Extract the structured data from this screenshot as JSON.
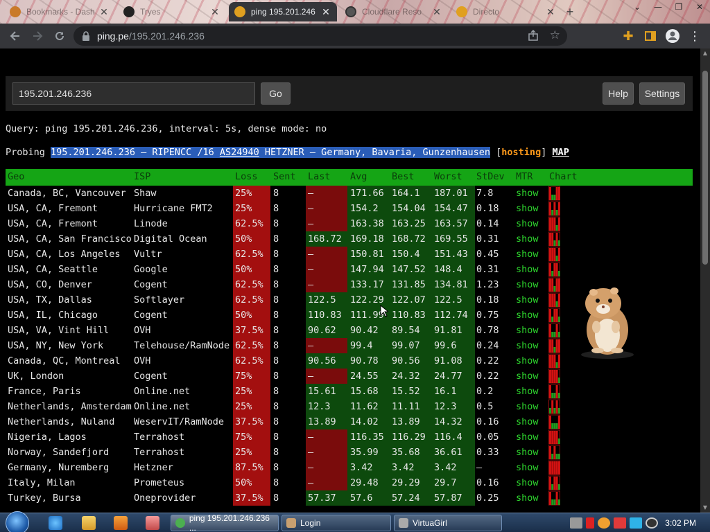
{
  "browser": {
    "tabs": [
      {
        "title": "Bookmarks - Dash",
        "favicon_color": "#c97a2a",
        "active": false
      },
      {
        "title": "Tryes",
        "favicon_color": "#222222",
        "active": false
      },
      {
        "title": "ping 195.201.246",
        "favicon_color": "#e0a020",
        "active": true
      },
      {
        "title": "Cloudflare Reso",
        "favicon_color": "#555555",
        "active": false
      },
      {
        "title": "Directo",
        "favicon_color": "#e0a020",
        "active": false
      }
    ],
    "new_tab_label": "+",
    "url_host": "ping.pe",
    "url_path": "/195.201.246.236"
  },
  "search": {
    "input_value": "195.201.246.236",
    "go_label": "Go",
    "help_label": "Help",
    "settings_label": "Settings"
  },
  "query_line": "Query: ping 195.201.246.236, interval: 5s, dense mode: no",
  "probe": {
    "prefix": "Probing ",
    "selected_a": "195.201.246.236 – RIPENCC /16 ",
    "asn": "AS24940",
    "selected_b": " HETZNER – Germany, Bavaria, Gunzenhausen",
    "open_bracket": " [",
    "hosting": "hosting",
    "close_bracket": "] ",
    "map": "MAP"
  },
  "table": {
    "headers": [
      "Geo",
      "ISP",
      "Loss",
      "Sent",
      "Last",
      "Avg",
      "Best",
      "Worst",
      "StDev",
      "MTR",
      "Chart"
    ],
    "rows": [
      {
        "geo": "Canada, BC, Vancouver",
        "isp": "Shaw",
        "loss": "25%",
        "sent": "8",
        "last": "–",
        "avg": "171.66",
        "best": "164.1",
        "worst": "187.01",
        "stdev": "7.8",
        "mtr": "show",
        "chart": [
          1,
          0,
          0,
          1,
          1
        ]
      },
      {
        "geo": "USA, CA, Fremont",
        "isp": "Hurricane FMT2",
        "loss": "25%",
        "sent": "8",
        "last": "–",
        "avg": "154.2",
        "best": "154.04",
        "worst": "154.47",
        "stdev": "0.18",
        "mtr": "show",
        "chart": [
          1,
          0,
          1,
          0,
          1
        ]
      },
      {
        "geo": "USA, CA, Fremont",
        "isp": "Linode",
        "loss": "62.5%",
        "sent": "8",
        "last": "–",
        "avg": "163.38",
        "best": "163.25",
        "worst": "163.57",
        "stdev": "0.14",
        "mtr": "show",
        "chart": [
          1,
          1,
          1,
          0,
          1
        ]
      },
      {
        "geo": "USA, CA, San Francisco",
        "isp": "Digital Ocean",
        "loss": "50%",
        "sent": "8",
        "last": "168.72",
        "avg": "169.18",
        "best": "168.72",
        "worst": "169.55",
        "stdev": "0.31",
        "mtr": "show",
        "chart": [
          1,
          1,
          0,
          1,
          0
        ]
      },
      {
        "geo": "USA, CA, Los Angeles",
        "isp": "Vultr",
        "loss": "62.5%",
        "sent": "8",
        "last": "–",
        "avg": "150.81",
        "best": "150.4",
        "worst": "151.43",
        "stdev": "0.45",
        "mtr": "show",
        "chart": [
          1,
          1,
          1,
          0,
          1
        ]
      },
      {
        "geo": "USA, CA, Seattle",
        "isp": "Google",
        "loss": "50%",
        "sent": "8",
        "last": "–",
        "avg": "147.94",
        "best": "147.52",
        "worst": "148.4",
        "stdev": "0.31",
        "mtr": "show",
        "chart": [
          1,
          0,
          1,
          1,
          0
        ]
      },
      {
        "geo": "USA, CO, Denver",
        "isp": "Cogent",
        "loss": "62.5%",
        "sent": "8",
        "last": "–",
        "avg": "133.17",
        "best": "131.85",
        "worst": "134.81",
        "stdev": "1.23",
        "mtr": "show",
        "chart": [
          1,
          1,
          0,
          1,
          1
        ]
      },
      {
        "geo": "USA, TX, Dallas",
        "isp": "Softlayer",
        "loss": "62.5%",
        "sent": "8",
        "last": "122.5",
        "avg": "122.29",
        "best": "122.07",
        "worst": "122.5",
        "stdev": "0.18",
        "mtr": "show",
        "chart": [
          1,
          1,
          1,
          0,
          1
        ]
      },
      {
        "geo": "USA, IL, Chicago",
        "isp": "Cogent",
        "loss": "50%",
        "sent": "8",
        "last": "110.83",
        "avg": "111.99",
        "best": "110.83",
        "worst": "112.74",
        "stdev": "0.75",
        "mtr": "show",
        "chart": [
          1,
          0,
          1,
          1,
          0
        ]
      },
      {
        "geo": "USA, VA, Vint Hill",
        "isp": "OVH",
        "loss": "37.5%",
        "sent": "8",
        "last": "90.62",
        "avg": "90.42",
        "best": "89.54",
        "worst": "91.81",
        "stdev": "0.78",
        "mtr": "show",
        "chart": [
          1,
          0,
          0,
          1,
          0
        ]
      },
      {
        "geo": "USA, NY, New York",
        "isp": "Telehouse/RamNode",
        "loss": "62.5%",
        "sent": "8",
        "last": "–",
        "avg": "99.4",
        "best": "99.07",
        "worst": "99.6",
        "stdev": "0.24",
        "mtr": "show",
        "chart": [
          1,
          1,
          0,
          1,
          1
        ]
      },
      {
        "geo": "Canada, QC, Montreal",
        "isp": "OVH",
        "loss": "62.5%",
        "sent": "8",
        "last": "90.56",
        "avg": "90.78",
        "best": "90.56",
        "worst": "91.08",
        "stdev": "0.22",
        "mtr": "show",
        "chart": [
          1,
          1,
          1,
          0,
          1
        ]
      },
      {
        "geo": "UK, London",
        "isp": "Cogent",
        "loss": "75%",
        "sent": "8",
        "last": "–",
        "avg": "24.55",
        "best": "24.32",
        "worst": "24.77",
        "stdev": "0.22",
        "mtr": "show",
        "chart": [
          1,
          1,
          1,
          1,
          0
        ]
      },
      {
        "geo": "France, Paris",
        "isp": "Online.net",
        "loss": "25%",
        "sent": "8",
        "last": "15.61",
        "avg": "15.68",
        "best": "15.52",
        "worst": "16.1",
        "stdev": "0.2",
        "mtr": "show",
        "chart": [
          1,
          0,
          0,
          1,
          0
        ]
      },
      {
        "geo": "Netherlands, Amsterdam",
        "isp": "Online.net",
        "loss": "25%",
        "sent": "8",
        "last": "12.3",
        "avg": "11.62",
        "best": "11.11",
        "worst": "12.3",
        "stdev": "0.5",
        "mtr": "show",
        "chart": [
          0,
          1,
          0,
          1,
          0
        ]
      },
      {
        "geo": "Netherlands, Nuland",
        "isp": "WeservIT/RamNode",
        "loss": "37.5%",
        "sent": "8",
        "last": "13.89",
        "avg": "14.02",
        "best": "13.89",
        "worst": "14.32",
        "stdev": "0.16",
        "mtr": "show",
        "chart": [
          1,
          0,
          0,
          0,
          1
        ]
      },
      {
        "geo": "Nigeria, Lagos",
        "isp": "Terrahost",
        "loss": "75%",
        "sent": "8",
        "last": "–",
        "avg": "116.35",
        "best": "116.29",
        "worst": "116.4",
        "stdev": "0.05",
        "mtr": "show",
        "chart": [
          1,
          1,
          1,
          1,
          0
        ]
      },
      {
        "geo": "Norway, Sandefjord",
        "isp": "Terrahost",
        "loss": "25%",
        "sent": "8",
        "last": "–",
        "avg": "35.99",
        "best": "35.68",
        "worst": "36.61",
        "stdev": "0.33",
        "mtr": "show",
        "chart": [
          1,
          0,
          1,
          0,
          0
        ]
      },
      {
        "geo": "Germany, Nuremberg",
        "isp": "Hetzner",
        "loss": "87.5%",
        "sent": "8",
        "last": "–",
        "avg": "3.42",
        "best": "3.42",
        "worst": "3.42",
        "stdev": "–",
        "mtr": "show",
        "chart": [
          1,
          1,
          1,
          1,
          1
        ]
      },
      {
        "geo": "Italy, Milan",
        "isp": "Prometeus",
        "loss": "50%",
        "sent": "8",
        "last": "–",
        "avg": "29.48",
        "best": "29.29",
        "worst": "29.7",
        "stdev": "0.16",
        "mtr": "show",
        "chart": [
          1,
          0,
          1,
          1,
          0
        ]
      },
      {
        "geo": "Turkey, Bursa",
        "isp": "Oneprovider",
        "loss": "37.5%",
        "sent": "8",
        "last": "57.37",
        "avg": "57.6",
        "best": "57.24",
        "worst": "57.87",
        "stdev": "0.25",
        "mtr": "show",
        "chart": [
          1,
          0,
          0,
          1,
          0
        ]
      }
    ]
  },
  "taskbar": {
    "tasks": [
      {
        "label": "ping 195.201.246.236 ...",
        "icon_color": "#4caf50",
        "active": true
      },
      {
        "label": "Login",
        "icon_color": "#c9a070",
        "active": false
      },
      {
        "label": "VirtuaGirl",
        "icon_color": "#aaaaaa",
        "active": false
      }
    ],
    "clock": "3:02 PM"
  },
  "colors": {
    "header_green": "#15a515",
    "loss_red": "#a30f0f",
    "show_green": "#2ed62e",
    "hosting_orange": "#ff9a1a",
    "selection_blue": "#2a5db7"
  }
}
